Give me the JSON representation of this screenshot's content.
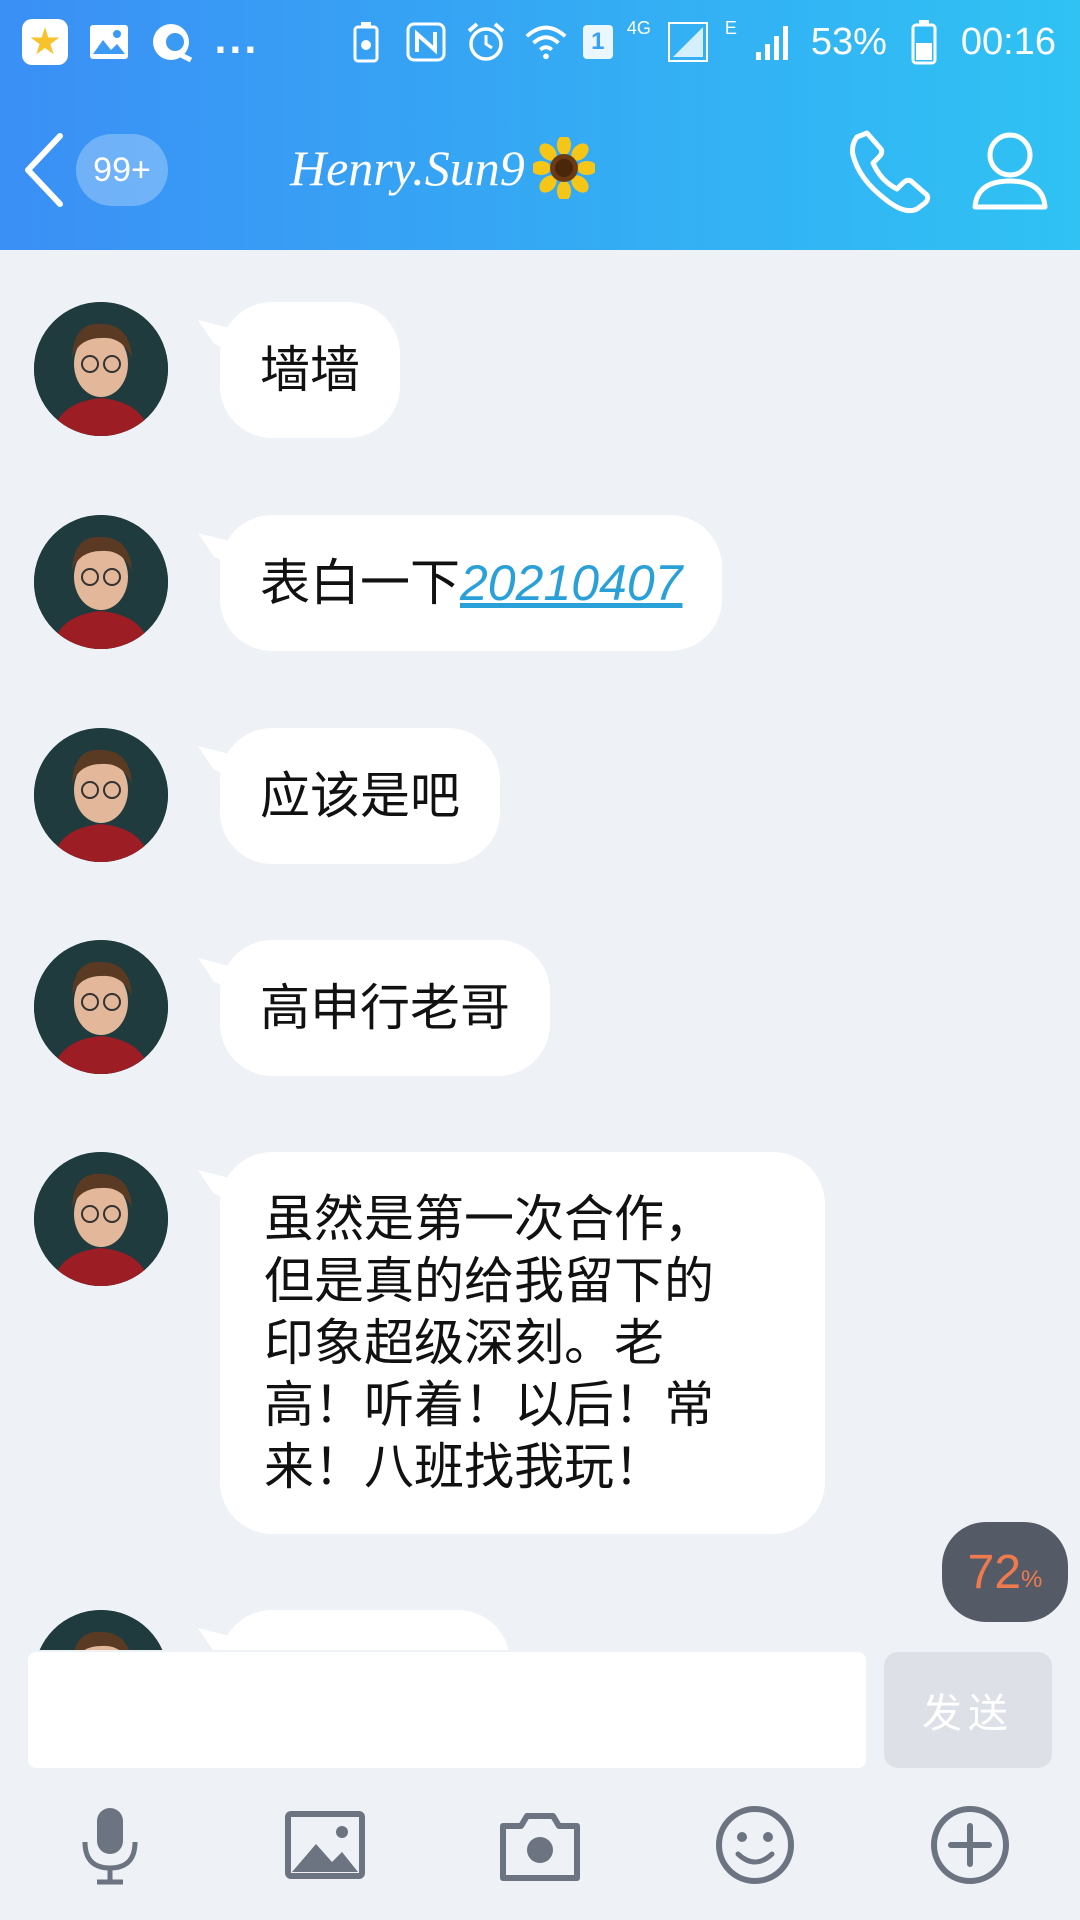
{
  "status_bar": {
    "overflow": "...",
    "sim_slot": "1",
    "network_4g": "4G",
    "network_e": "E",
    "battery": "53%",
    "time": "00:16"
  },
  "header": {
    "unread_count": "99+",
    "contact_name": "Henry.Sun9",
    "name_emoji_icon": "sunflower-icon"
  },
  "messages": [
    {
      "text": "墙墙"
    },
    {
      "text": "表白一下",
      "link": "20210407"
    },
    {
      "text": "应该是吧"
    },
    {
      "text": "高申行老哥"
    },
    {
      "lines": [
        "虽然是第一次合作，",
        "但是真的给我留下的",
        "印象超级深刻。老",
        "高！听着！以后！常",
        "来！八班找我玩！"
      ]
    }
  ],
  "progress": {
    "value": "72",
    "unit": "%"
  },
  "input": {
    "value": "",
    "placeholder": "",
    "send_label": "发送"
  },
  "toolbar": [
    "microphone-icon",
    "image-icon",
    "camera-icon",
    "emoji-icon",
    "plus-icon"
  ],
  "colors": {
    "header_gradient_start": "#3b8ff5",
    "header_gradient_end": "#2fc2f3",
    "chat_background": "#eef1f6",
    "link": "#2aa0d8",
    "progress_text": "#f07a4e"
  }
}
